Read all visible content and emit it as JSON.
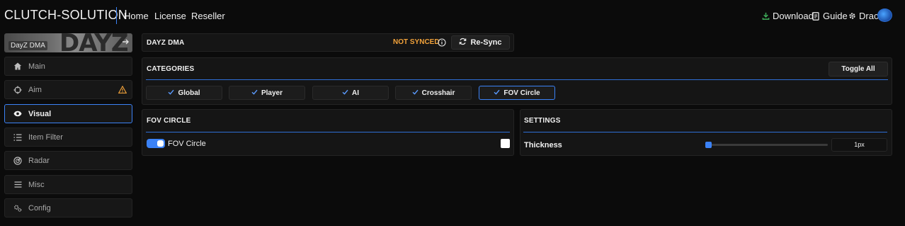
{
  "brand": "CLUTCH-SOLUTION",
  "nav": {
    "home": "Home",
    "license": "License",
    "reseller": "Reseller"
  },
  "nav_right": {
    "download": "Download",
    "guide": "Guide",
    "user": "Drac"
  },
  "sidebar": {
    "game_label": "DayZ DMA",
    "game_logo_text": "DAYZ",
    "items": [
      {
        "label": "Main",
        "icon": "home-icon"
      },
      {
        "label": "Aim",
        "icon": "crosshair-icon",
        "warning": true
      },
      {
        "label": "Visual",
        "icon": "eye-icon",
        "active": true
      },
      {
        "label": "Item Filter",
        "icon": "list-icon"
      },
      {
        "label": "Radar",
        "icon": "radar-icon"
      },
      {
        "label": "Misc",
        "icon": "menu-icon"
      },
      {
        "label": "Config",
        "icon": "gears-icon"
      }
    ]
  },
  "header_panel": {
    "title": "DAYZ DMA",
    "status": "NOT SYNCED",
    "resync": "Re-Sync"
  },
  "categories_panel": {
    "title": "CATEGORIES",
    "toggle_all": "Toggle All",
    "items": [
      {
        "label": "Global",
        "checked": true
      },
      {
        "label": "Player",
        "checked": true
      },
      {
        "label": "AI",
        "checked": true
      },
      {
        "label": "Crosshair",
        "checked": true
      },
      {
        "label": "FOV Circle",
        "checked": true,
        "active": true
      }
    ]
  },
  "fov_panel": {
    "title": "FOV CIRCLE",
    "toggle_label": "FOV Circle",
    "enabled": true,
    "color": "#ffffff"
  },
  "settings_panel": {
    "title": "SETTINGS",
    "thickness_label": "Thickness",
    "thickness_value": "1px"
  },
  "colors": {
    "accent": "#3b82f6",
    "warning": "#f2a23a",
    "background": "#0b0b0b",
    "panel": "#151515"
  }
}
